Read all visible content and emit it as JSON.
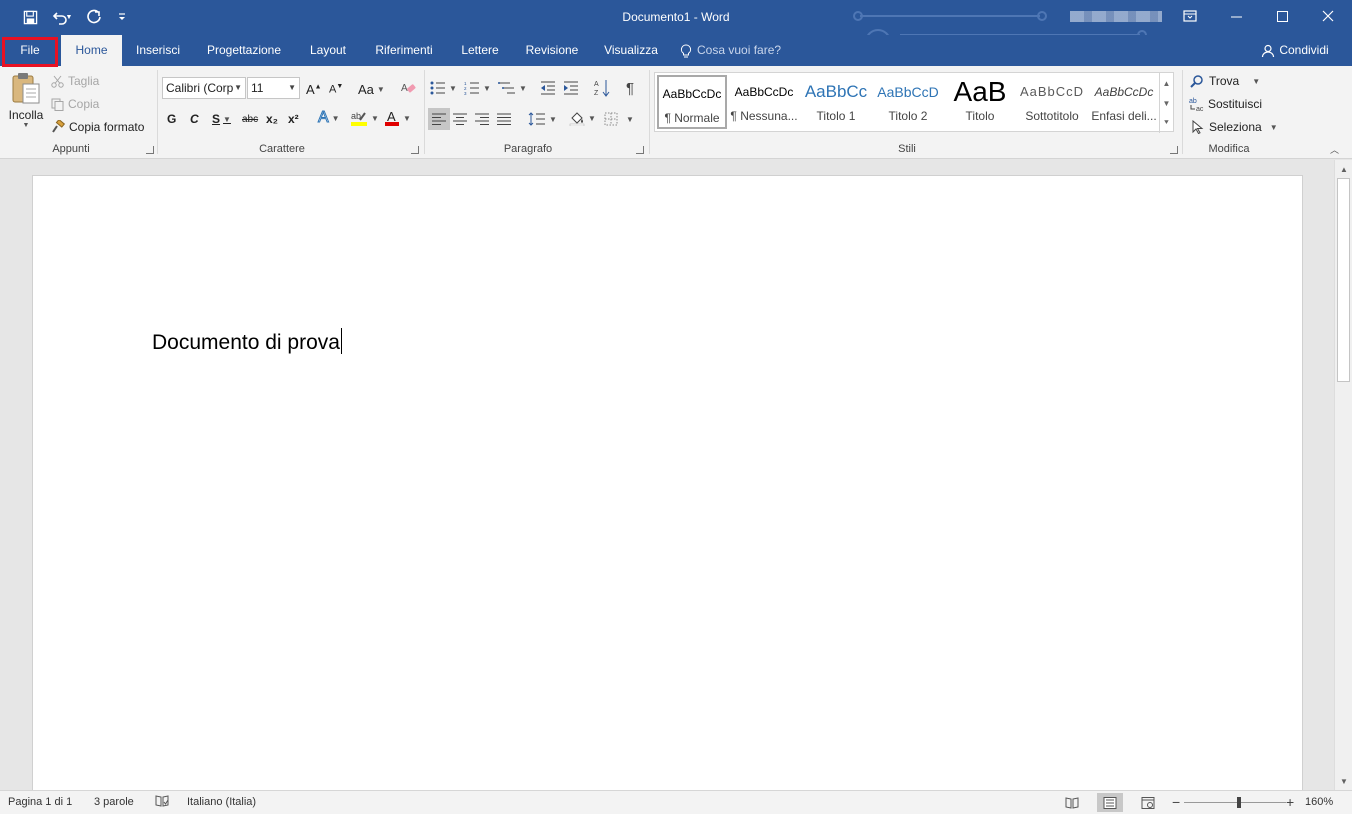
{
  "window": {
    "title": "Documento1  -  Word",
    "qat": [
      "save-icon",
      "undo-icon",
      "redo-icon",
      "customize-qat-icon"
    ],
    "controls": [
      "ribbon-display-icon",
      "minimize-icon",
      "maximize-icon",
      "close-icon"
    ]
  },
  "tabs": {
    "file": "File",
    "home": "Home",
    "insert": "Inserisci",
    "design": "Progettazione",
    "layout": "Layout",
    "references": "Riferimenti",
    "mailings": "Lettere",
    "review": "Revisione",
    "view": "Visualizza",
    "tell_me": "Cosa vuoi fare?",
    "share": "Condividi"
  },
  "clipboard": {
    "paste": "Incolla",
    "cut": "Taglia",
    "copy": "Copia",
    "format_painter": "Copia formato",
    "label": "Appunti"
  },
  "font": {
    "name": "Calibri (Corp",
    "size": "11",
    "label": "Carattere",
    "bold": "G",
    "italic": "C",
    "underline": "S",
    "strike": "abc",
    "subscript": "x₂",
    "superscript": "x²",
    "case": "Aa",
    "highlight_color": "#ffff00",
    "font_color": "#e00000"
  },
  "paragraph": {
    "label": "Paragrafo"
  },
  "styles": {
    "label": "Stili",
    "items": [
      {
        "preview": "AaBbCcDc",
        "name": "¶ Normale"
      },
      {
        "preview": "AaBbCcDc",
        "name": "¶ Nessuna..."
      },
      {
        "preview": "AaBbCc",
        "name": "Titolo 1"
      },
      {
        "preview": "AaBbCcD",
        "name": "Titolo 2"
      },
      {
        "preview": "AaB",
        "name": "Titolo"
      },
      {
        "preview": "AaBbCcD",
        "name": "Sottotitolo"
      },
      {
        "preview": "AaBbCcDc",
        "name": "Enfasi deli..."
      }
    ]
  },
  "editing": {
    "find": "Trova",
    "replace": "Sostituisci",
    "select": "Seleziona",
    "label": "Modifica"
  },
  "document": {
    "text": "Documento di prova"
  },
  "status": {
    "page": "Pagina 1 di 1",
    "words": "3 parole",
    "language": "Italiano (Italia)",
    "zoom": "160%",
    "zoom_level": 160
  },
  "colors": {
    "accent": "#2b579a",
    "file_highlight": "#e81123",
    "ribbon_bg": "#f3f3f3"
  }
}
